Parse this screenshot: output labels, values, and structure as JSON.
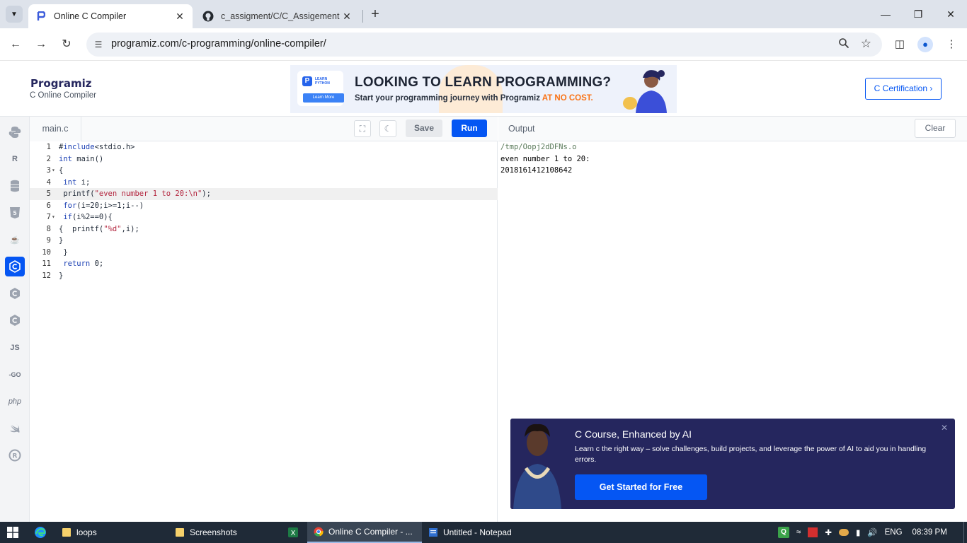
{
  "browser": {
    "tabs": [
      {
        "title": "Online C Compiler",
        "icon": "programiz-icon",
        "active": true
      },
      {
        "title": "c_assigment/C/C_Assigement at",
        "icon": "github-icon",
        "active": false
      }
    ],
    "url": "programiz.com/c-programming/online-compiler/"
  },
  "header": {
    "logo": "Programiz",
    "subtitle": "C Online Compiler",
    "banner": {
      "tag": "LEARN PYTHON",
      "tag_button": "Learn More",
      "headline": "LOOKING TO LEARN PROGRAMMING?",
      "sub_prefix": "Start your programming journey with Programiz ",
      "sub_highlight": "AT NO COST."
    },
    "cert_button": "C Certification ›"
  },
  "rail": [
    "python",
    "r",
    "sql",
    "html",
    "java",
    "c",
    "cpp",
    "csharp",
    "js",
    "go",
    "php",
    "swift",
    "rust"
  ],
  "editor": {
    "file_tab": "main.c",
    "save_label": "Save",
    "run_label": "Run",
    "lines": [
      {
        "n": "1",
        "fold": "",
        "code": "#include<stdio.h>"
      },
      {
        "n": "2",
        "fold": "",
        "code": "int main()"
      },
      {
        "n": "3",
        "fold": "▾",
        "code": "{"
      },
      {
        "n": "4",
        "fold": "",
        "code": " int i;"
      },
      {
        "n": "5",
        "fold": "",
        "code": " printf(\"even number 1 to 20:\\n\");",
        "current": true
      },
      {
        "n": "6",
        "fold": "",
        "code": " for(i=20;i>=1;i--)"
      },
      {
        "n": "7",
        "fold": "▾",
        "code": " if(i%2==0){"
      },
      {
        "n": "8",
        "fold": "",
        "code": "{  printf(\"%d\",i);"
      },
      {
        "n": "9",
        "fold": "",
        "code": "}"
      },
      {
        "n": "10",
        "fold": "",
        "code": " }"
      },
      {
        "n": "11",
        "fold": "",
        "code": " return 0;"
      },
      {
        "n": "12",
        "fold": "",
        "code": "}"
      }
    ]
  },
  "output": {
    "title": "Output",
    "clear_label": "Clear",
    "lines": [
      "/tmp/Oopj2dDFNs.o",
      "even number 1 to 20:",
      "2018161412108642"
    ]
  },
  "promo": {
    "title": "C Course, Enhanced by AI",
    "description": "Learn c the right way – solve challenges, build projects, and leverage the power of AI to aid you in handling errors.",
    "button": "Get Started for Free"
  },
  "taskbar": {
    "apps": [
      "loops",
      "Screenshots",
      "Online C Compiler - ...",
      "Untitled - Notepad"
    ],
    "lang": "ENG",
    "time": "08:39 PM"
  },
  "colors": {
    "accent": "#0556f3",
    "navy": "#25265e",
    "highlight": "#f97316"
  }
}
